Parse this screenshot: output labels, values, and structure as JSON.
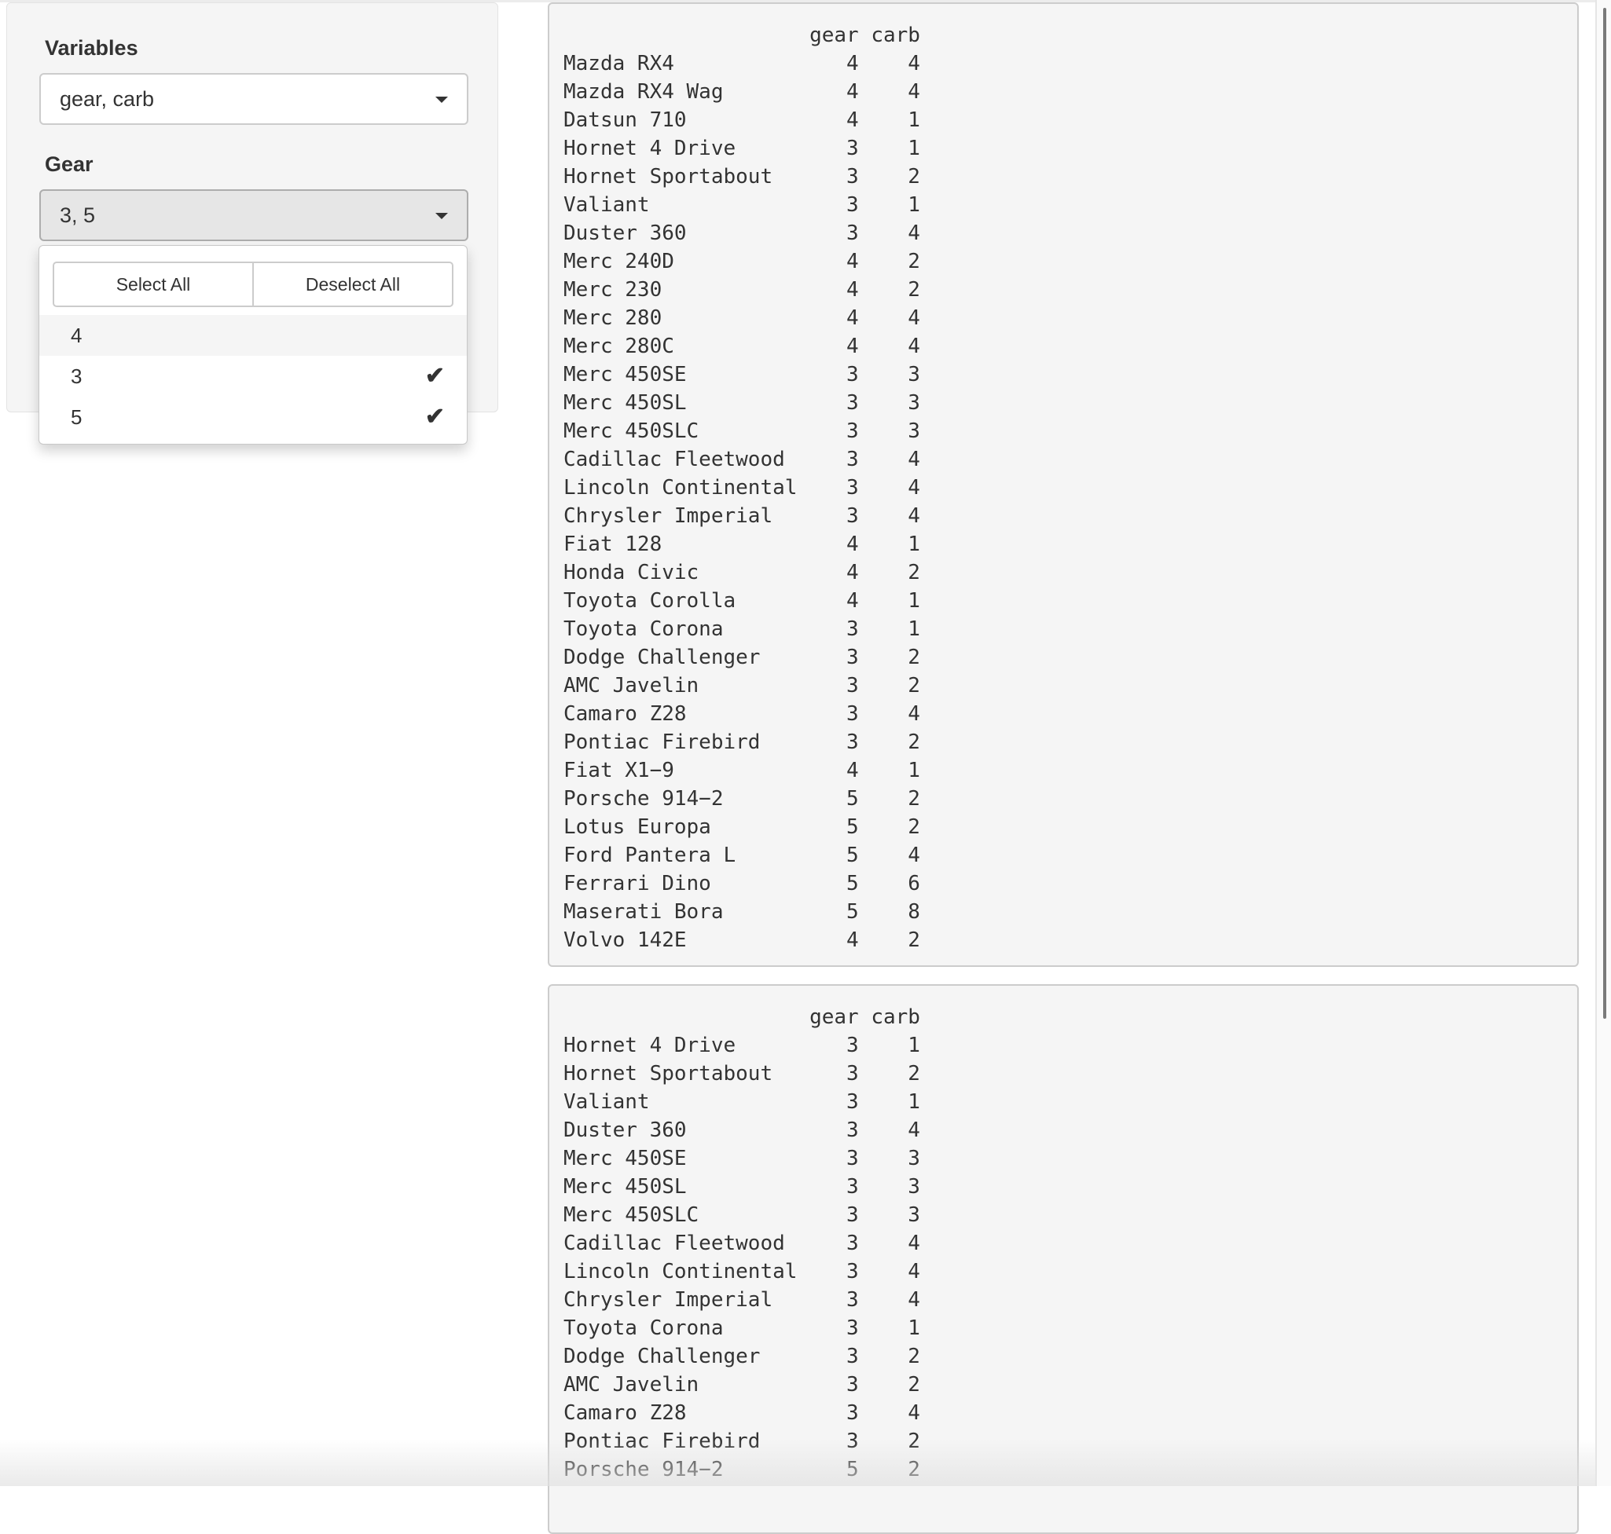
{
  "sidebar": {
    "variables_label": "Variables",
    "variables_value": "gear, carb",
    "gear_label": "Gear",
    "gear_value": "3, 5",
    "menu": {
      "select_all": "Select All",
      "deselect_all": "Deselect All",
      "options": [
        {
          "label": "4",
          "selected": false,
          "hovered": true
        },
        {
          "label": "3",
          "selected": true,
          "hovered": false
        },
        {
          "label": "5",
          "selected": true,
          "hovered": false
        }
      ]
    }
  },
  "icons": {
    "caret": "caret-down-icon",
    "check": "checkmark-icon"
  },
  "scrollbar": {
    "thumb_fraction": 0.68,
    "position_fraction": 0.0
  },
  "tables": [
    {
      "columns": [
        "gear",
        "carb"
      ],
      "rows": [
        [
          "Mazda RX4",
          4,
          4
        ],
        [
          "Mazda RX4 Wag",
          4,
          4
        ],
        [
          "Datsun 710",
          4,
          1
        ],
        [
          "Hornet 4 Drive",
          3,
          1
        ],
        [
          "Hornet Sportabout",
          3,
          2
        ],
        [
          "Valiant",
          3,
          1
        ],
        [
          "Duster 360",
          3,
          4
        ],
        [
          "Merc 240D",
          4,
          2
        ],
        [
          "Merc 230",
          4,
          2
        ],
        [
          "Merc 280",
          4,
          4
        ],
        [
          "Merc 280C",
          4,
          4
        ],
        [
          "Merc 450SE",
          3,
          3
        ],
        [
          "Merc 450SL",
          3,
          3
        ],
        [
          "Merc 450SLC",
          3,
          3
        ],
        [
          "Cadillac Fleetwood",
          3,
          4
        ],
        [
          "Lincoln Continental",
          3,
          4
        ],
        [
          "Chrysler Imperial",
          3,
          4
        ],
        [
          "Fiat 128",
          4,
          1
        ],
        [
          "Honda Civic",
          4,
          2
        ],
        [
          "Toyota Corolla",
          4,
          1
        ],
        [
          "Toyota Corona",
          3,
          1
        ],
        [
          "Dodge Challenger",
          3,
          2
        ],
        [
          "AMC Javelin",
          3,
          2
        ],
        [
          "Camaro Z28",
          3,
          4
        ],
        [
          "Pontiac Firebird",
          3,
          2
        ],
        [
          "Fiat X1−9",
          4,
          1
        ],
        [
          "Porsche 914−2",
          5,
          2
        ],
        [
          "Lotus Europa",
          5,
          2
        ],
        [
          "Ford Pantera L",
          5,
          4
        ],
        [
          "Ferrari Dino",
          5,
          6
        ],
        [
          "Maserati Bora",
          5,
          8
        ],
        [
          "Volvo 142E",
          4,
          2
        ]
      ]
    },
    {
      "columns": [
        "gear",
        "carb"
      ],
      "rows": [
        [
          "Hornet 4 Drive",
          3,
          1
        ],
        [
          "Hornet Sportabout",
          3,
          2
        ],
        [
          "Valiant",
          3,
          1
        ],
        [
          "Duster 360",
          3,
          4
        ],
        [
          "Merc 450SE",
          3,
          3
        ],
        [
          "Merc 450SL",
          3,
          3
        ],
        [
          "Merc 450SLC",
          3,
          3
        ],
        [
          "Cadillac Fleetwood",
          3,
          4
        ],
        [
          "Lincoln Continental",
          3,
          4
        ],
        [
          "Chrysler Imperial",
          3,
          4
        ],
        [
          "Toyota Corona",
          3,
          1
        ],
        [
          "Dodge Challenger",
          3,
          2
        ],
        [
          "AMC Javelin",
          3,
          2
        ],
        [
          "Camaro Z28",
          3,
          4
        ],
        [
          "Pontiac Firebird",
          3,
          2
        ],
        [
          "Porsche 914−2",
          5,
          2
        ]
      ]
    }
  ]
}
